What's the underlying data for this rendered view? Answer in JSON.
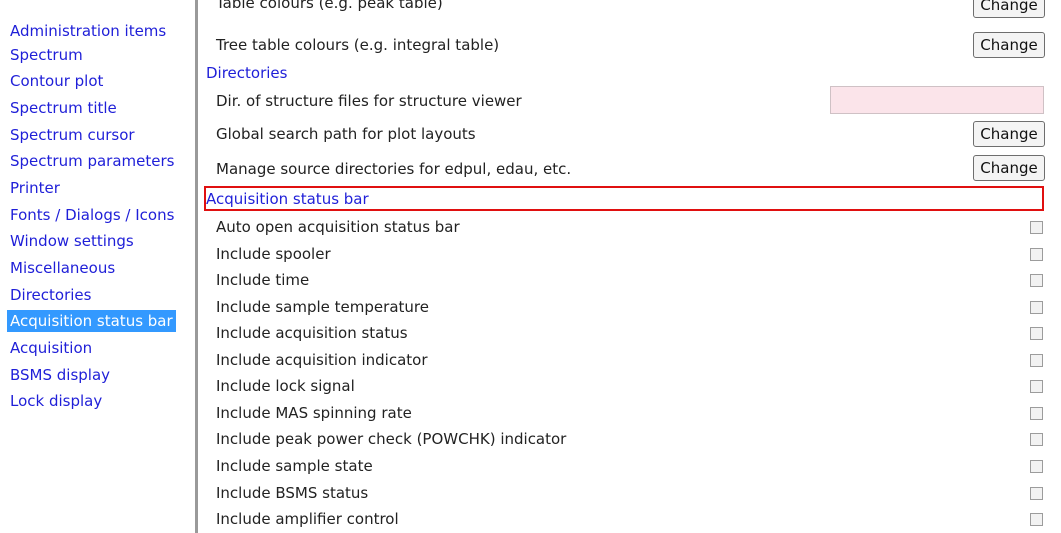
{
  "sidebar": {
    "items": [
      {
        "label": "Administration items"
      },
      {
        "label": "Spectrum"
      },
      {
        "label": "Contour plot"
      },
      {
        "label": "Spectrum title"
      },
      {
        "label": "Spectrum cursor"
      },
      {
        "label": "Spectrum parameters"
      },
      {
        "label": "Printer"
      },
      {
        "label": "Fonts / Dialogs / Icons"
      },
      {
        "label": "Window settings"
      },
      {
        "label": "Miscellaneous"
      },
      {
        "label": "Directories"
      },
      {
        "label": "Acquisition status bar",
        "selected": true
      },
      {
        "label": "Acquisition"
      },
      {
        "label": "BSMS display"
      },
      {
        "label": "Lock display"
      }
    ]
  },
  "content": {
    "table_colours": {
      "label": "Table colours (e.g. peak table)",
      "button": "Change"
    },
    "tree_table_colours": {
      "label": "Tree table colours (e.g. integral table)",
      "button": "Change"
    },
    "directories": {
      "heading": "Directories",
      "structure_files": {
        "label": "Dir. of structure files for structure viewer",
        "value": ""
      },
      "plot_layouts": {
        "label": "Global search path for plot layouts",
        "button": "Change"
      },
      "source_dirs": {
        "label": "Manage source directories for edpul, edau, etc.",
        "button": "Change"
      }
    },
    "acquisition_status_bar": {
      "heading": "Acquisition status bar",
      "options": [
        {
          "label": "Auto open acquisition status bar",
          "checked": false
        },
        {
          "label": "Include spooler",
          "checked": false
        },
        {
          "label": "Include time",
          "checked": false
        },
        {
          "label": "Include sample temperature",
          "checked": false
        },
        {
          "label": "Include acquisition status",
          "checked": false
        },
        {
          "label": "Include acquisition indicator",
          "checked": false
        },
        {
          "label": "Include lock signal",
          "checked": false
        },
        {
          "label": "Include MAS spinning rate",
          "checked": false
        },
        {
          "label": "Include peak power check (POWCHK) indicator",
          "checked": false
        },
        {
          "label": "Include sample state",
          "checked": false
        },
        {
          "label": "Include BSMS status",
          "checked": false
        },
        {
          "label": "Include amplifier control",
          "checked": false
        }
      ]
    }
  },
  "colors": {
    "link": "#1f1fd8",
    "selected_bg": "#3399ff",
    "highlight_border": "#e01010",
    "input_bg": "#fbe4ea"
  }
}
